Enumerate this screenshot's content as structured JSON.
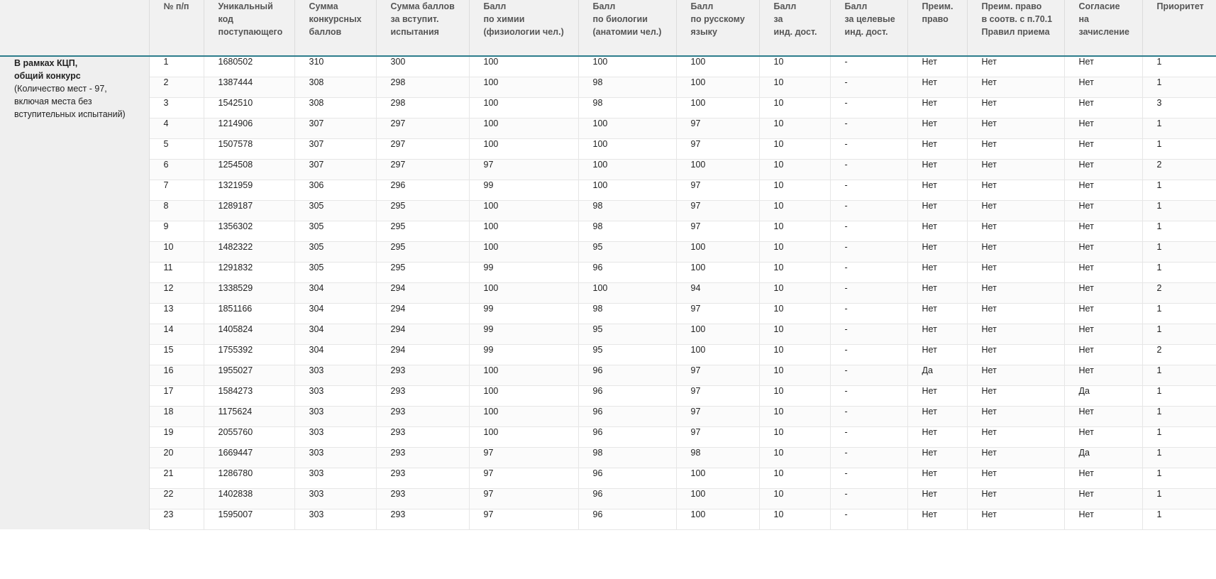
{
  "table": {
    "headers": [
      [
        ""
      ],
      [
        "№ п/п"
      ],
      [
        "Уникальный",
        "код",
        "поступающего"
      ],
      [
        "Сумма",
        "конкурсных",
        "баллов"
      ],
      [
        "Сумма баллов",
        "за вступит.",
        "испытания"
      ],
      [
        "Балл",
        "по химии",
        "(физиологии чел.)"
      ],
      [
        "Балл",
        "по биологии",
        "(анатомии чел.)"
      ],
      [
        "Балл",
        "по русскому",
        "языку"
      ],
      [
        "Балл",
        "за",
        "инд. дост."
      ],
      [
        "Балл",
        "за целевые",
        "инд. дост."
      ],
      [
        "Преим.",
        "право"
      ],
      [
        "Преим. право",
        "в соотв. с п.70.1",
        "Правил приема"
      ],
      [
        "Согласие",
        "на",
        "зачисление"
      ],
      [
        "Приоритет"
      ]
    ],
    "group": {
      "title_line1": "В рамках КЦП,",
      "title_line2": "общий конкурс",
      "desc_line1": "(Количество мест - 97,",
      "desc_line2": "включая места без",
      "desc_line3": "вступительных испытаний)"
    },
    "rows": [
      [
        "1",
        "1680502",
        "310",
        "300",
        "100",
        "100",
        "100",
        "10",
        "-",
        "Нет",
        "Нет",
        "Нет",
        "1"
      ],
      [
        "2",
        "1387444",
        "308",
        "298",
        "100",
        "98",
        "100",
        "10",
        "-",
        "Нет",
        "Нет",
        "Нет",
        "1"
      ],
      [
        "3",
        "1542510",
        "308",
        "298",
        "100",
        "98",
        "100",
        "10",
        "-",
        "Нет",
        "Нет",
        "Нет",
        "3"
      ],
      [
        "4",
        "1214906",
        "307",
        "297",
        "100",
        "100",
        "97",
        "10",
        "-",
        "Нет",
        "Нет",
        "Нет",
        "1"
      ],
      [
        "5",
        "1507578",
        "307",
        "297",
        "100",
        "100",
        "97",
        "10",
        "-",
        "Нет",
        "Нет",
        "Нет",
        "1"
      ],
      [
        "6",
        "1254508",
        "307",
        "297",
        "97",
        "100",
        "100",
        "10",
        "-",
        "Нет",
        "Нет",
        "Нет",
        "2"
      ],
      [
        "7",
        "1321959",
        "306",
        "296",
        "99",
        "100",
        "97",
        "10",
        "-",
        "Нет",
        "Нет",
        "Нет",
        "1"
      ],
      [
        "8",
        "1289187",
        "305",
        "295",
        "100",
        "98",
        "97",
        "10",
        "-",
        "Нет",
        "Нет",
        "Нет",
        "1"
      ],
      [
        "9",
        "1356302",
        "305",
        "295",
        "100",
        "98",
        "97",
        "10",
        "-",
        "Нет",
        "Нет",
        "Нет",
        "1"
      ],
      [
        "10",
        "1482322",
        "305",
        "295",
        "100",
        "95",
        "100",
        "10",
        "-",
        "Нет",
        "Нет",
        "Нет",
        "1"
      ],
      [
        "11",
        "1291832",
        "305",
        "295",
        "99",
        "96",
        "100",
        "10",
        "-",
        "Нет",
        "Нет",
        "Нет",
        "1"
      ],
      [
        "12",
        "1338529",
        "304",
        "294",
        "100",
        "100",
        "94",
        "10",
        "-",
        "Нет",
        "Нет",
        "Нет",
        "2"
      ],
      [
        "13",
        "1851166",
        "304",
        "294",
        "99",
        "98",
        "97",
        "10",
        "-",
        "Нет",
        "Нет",
        "Нет",
        "1"
      ],
      [
        "14",
        "1405824",
        "304",
        "294",
        "99",
        "95",
        "100",
        "10",
        "-",
        "Нет",
        "Нет",
        "Нет",
        "1"
      ],
      [
        "15",
        "1755392",
        "304",
        "294",
        "99",
        "95",
        "100",
        "10",
        "-",
        "Нет",
        "Нет",
        "Нет",
        "2"
      ],
      [
        "16",
        "1955027",
        "303",
        "293",
        "100",
        "96",
        "97",
        "10",
        "-",
        "Да",
        "Нет",
        "Нет",
        "1"
      ],
      [
        "17",
        "1584273",
        "303",
        "293",
        "100",
        "96",
        "97",
        "10",
        "-",
        "Нет",
        "Нет",
        "Да",
        "1"
      ],
      [
        "18",
        "1175624",
        "303",
        "293",
        "100",
        "96",
        "97",
        "10",
        "-",
        "Нет",
        "Нет",
        "Нет",
        "1"
      ],
      [
        "19",
        "2055760",
        "303",
        "293",
        "100",
        "96",
        "97",
        "10",
        "-",
        "Нет",
        "Нет",
        "Нет",
        "1"
      ],
      [
        "20",
        "1669447",
        "303",
        "293",
        "97",
        "98",
        "98",
        "10",
        "-",
        "Нет",
        "Нет",
        "Да",
        "1"
      ],
      [
        "21",
        "1286780",
        "303",
        "293",
        "97",
        "96",
        "100",
        "10",
        "-",
        "Нет",
        "Нет",
        "Нет",
        "1"
      ],
      [
        "22",
        "1402838",
        "303",
        "293",
        "97",
        "96",
        "100",
        "10",
        "-",
        "Нет",
        "Нет",
        "Нет",
        "1"
      ],
      [
        "23",
        "1595007",
        "303",
        "293",
        "97",
        "96",
        "100",
        "10",
        "-",
        "Нет",
        "Нет",
        "Нет",
        "1"
      ]
    ]
  }
}
